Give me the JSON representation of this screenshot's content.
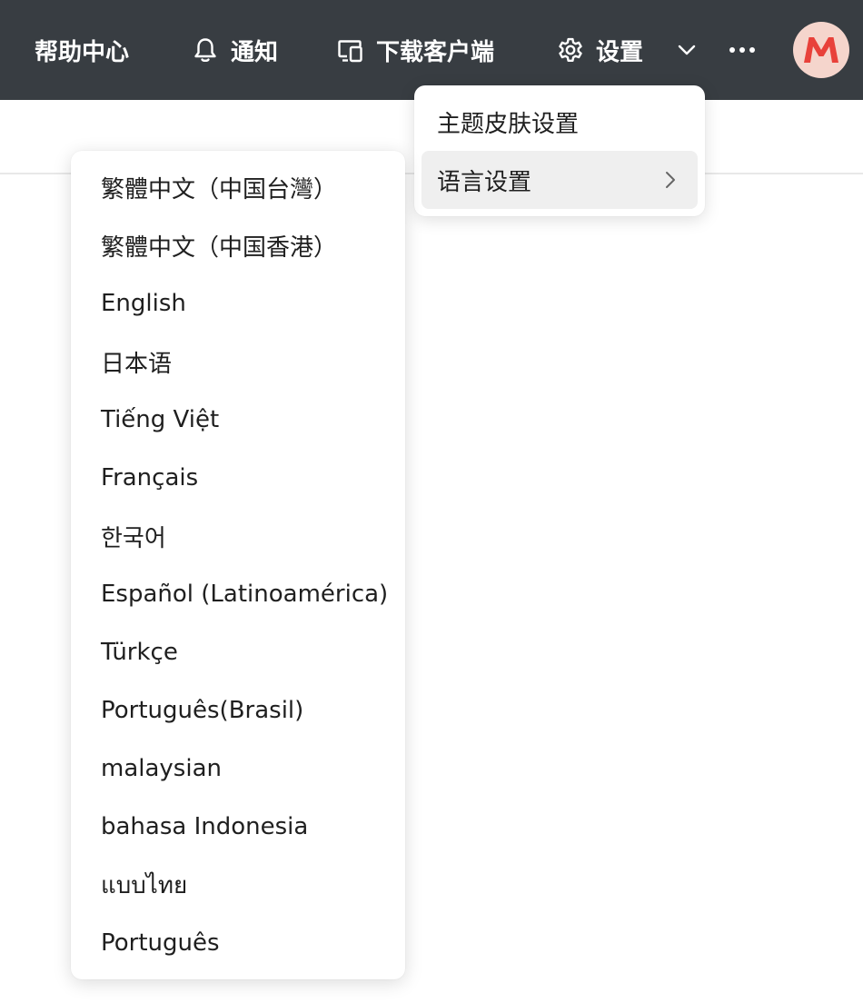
{
  "topbar": {
    "help_label": "帮助中心",
    "notify_label": "通知",
    "download_label": "下载客户端",
    "settings_label": "设置",
    "bg_color": "#383d42",
    "avatar_letter": "M"
  },
  "settings_menu": {
    "items": [
      {
        "label": "主题皮肤设置"
      },
      {
        "label": "语言设置",
        "active": true
      }
    ]
  },
  "language_menu": {
    "items": [
      "繁體中文（中国台灣）",
      "繁體中文（中国香港）",
      "English",
      "日本语",
      "Tiếng Việt",
      "Français",
      "한국어",
      "Español (Latinoamérica)",
      "Türkçe",
      "Português(Brasil)",
      "malaysian",
      "bahasa Indonesia",
      "แบบไทย",
      "Português"
    ]
  }
}
